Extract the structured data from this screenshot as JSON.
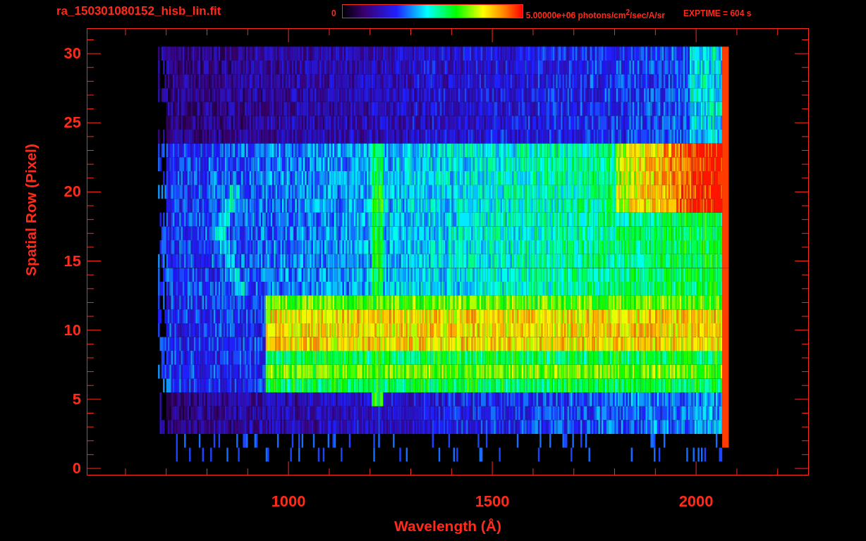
{
  "title": "ra_150301080152_hisb_lin.fit",
  "colorbar": {
    "min_label": "0",
    "max_label": "5.00000e+06 photons/cm$^{2}$/sec/A/sr"
  },
  "exposure": "EXPTIME = 604 s",
  "plot": {
    "ylabel": "Spatial Row (Pixel)",
    "xlabel": "Wavelength (Å)",
    "yticks": [
      "30",
      "25",
      "20",
      "15",
      "10",
      "5",
      "0"
    ],
    "xticks": [
      "1000",
      "1500",
      "2000"
    ]
  }
}
